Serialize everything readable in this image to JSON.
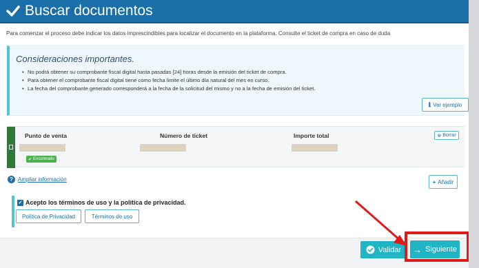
{
  "header": {
    "title": "Buscar documentos"
  },
  "intro": "Para comenzar el proceso debe indicar los datos imprescindibles para localizar el documento en la plataforma. Consulte el ticket de compra en caso de duda",
  "considerations": {
    "title": "Consideraciones importantes.",
    "items": [
      "No podrá obtener su comprobante fiscal digital hasta pasadas [24] horas desde la emisión del ticket de compra.",
      "Para obtener el comprobante fiscal digital tiene como fecha límite el último día natural del mes en curso.",
      "La fecha del comprobante generado corresponderá a la fecha de la solicitud del mismo y no a la fecha de emisión del ticket."
    ],
    "example_button": "Ver ejemplo"
  },
  "ticket": {
    "columns": [
      "Punto de venta",
      "Número de ticket",
      "Importe total"
    ],
    "status_badge": "Encontrado",
    "delete_button": "Borrar"
  },
  "more_info_link": "Ampliar información",
  "add_button": "Añadir",
  "terms": {
    "label": "Acepto los términos de uso y la política de privacidad.",
    "privacy_button": "Política de Privacidad",
    "terms_button": "Términos de uso"
  },
  "footer": {
    "validate_button": "Validar",
    "next_button": "Siguiente"
  },
  "colors": {
    "header": "#1a6fa8",
    "accent": "#1fb5c5",
    "highlight": "#e01a1a",
    "status": "#4caf50"
  }
}
